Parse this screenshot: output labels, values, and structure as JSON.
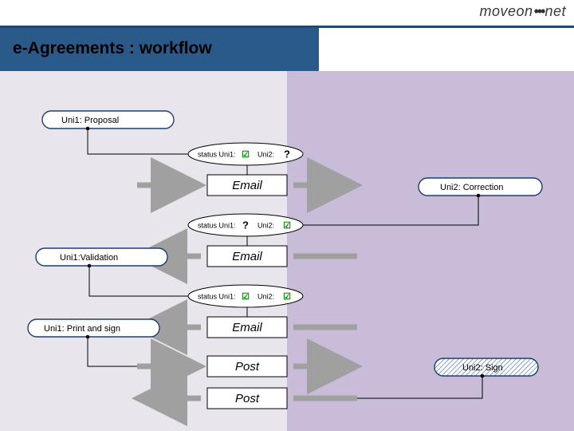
{
  "logo": {
    "left": "moveon",
    "right": "net"
  },
  "title": "e-Agreements : workflow",
  "nodes": {
    "proposal": "Uni1: Proposal",
    "validation": "Uni1:Validation",
    "print": "Uni1: Print and sign",
    "correction": "Uni2: Correction",
    "sign": "Uni2: Sign"
  },
  "status": {
    "uni1label": "status Uni1:",
    "uni2label": "Uni2:",
    "check": "☑",
    "question": "?"
  },
  "channels": {
    "email": "Email",
    "post": "Post"
  }
}
